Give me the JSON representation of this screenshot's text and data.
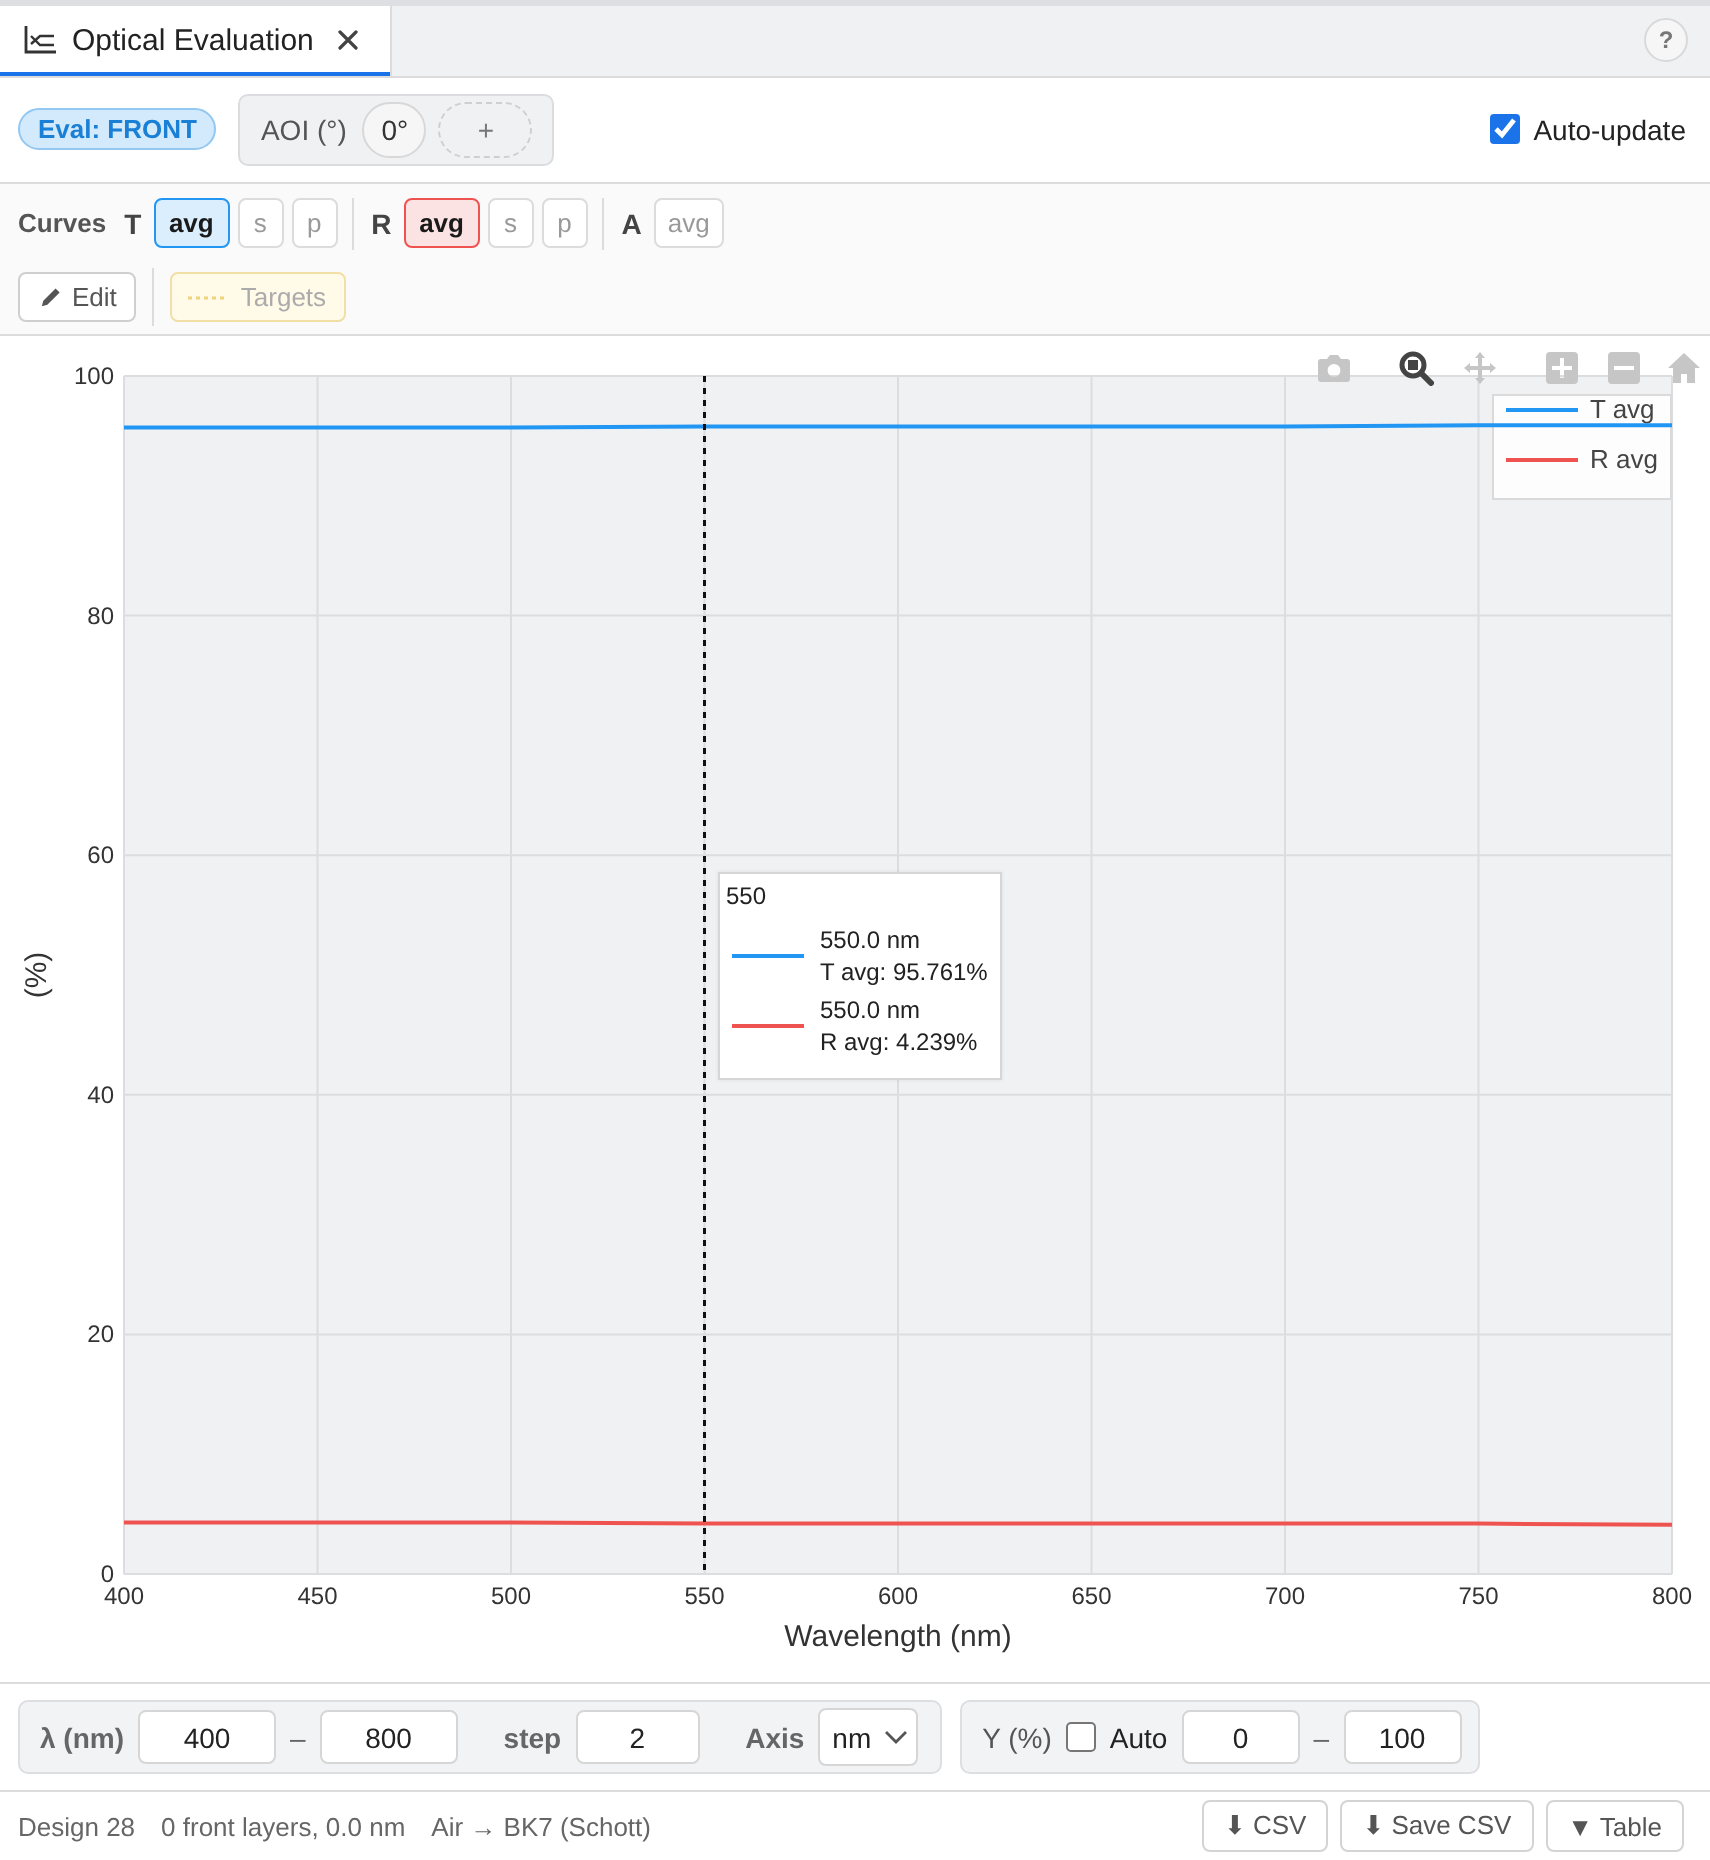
{
  "tab_bar": {
    "tabs": [
      {
        "label": "Optical Evaluation",
        "selected": true
      }
    ],
    "help": "?"
  },
  "toolbar": {
    "eval_badge": "Eval: FRONT",
    "aoi": {
      "label": "AOI (°)",
      "angles": [
        "0°"
      ],
      "add": "+"
    },
    "auto_update": {
      "label": "Auto-update",
      "checked": true
    }
  },
  "curves": {
    "label": "Curves",
    "groups": [
      {
        "name": "T",
        "color": "#2196f3",
        "options": [
          {
            "label": "avg",
            "selected": true
          },
          {
            "label": "s",
            "selected": false
          },
          {
            "label": "p",
            "selected": false
          }
        ]
      },
      {
        "name": "R",
        "color": "#ef5350",
        "options": [
          {
            "label": "avg",
            "selected": true
          },
          {
            "label": "s",
            "selected": false
          },
          {
            "label": "p",
            "selected": false
          }
        ]
      },
      {
        "name": "A",
        "options": [
          {
            "label": "avg",
            "selected": false
          }
        ]
      }
    ],
    "edit": "Edit",
    "targets": {
      "label": "Targets",
      "disabled": true
    }
  },
  "chart": {
    "modebar": [
      {
        "kind": "camera",
        "selected": false
      },
      {
        "kind": "zoom",
        "selected": true
      },
      {
        "kind": "pan",
        "selected": false
      },
      {
        "kind": "zoom_in",
        "selected": false
      },
      {
        "kind": "zoom_out",
        "selected": false
      },
      {
        "kind": "home",
        "selected": false
      }
    ],
    "chart_data": {
      "type": "line",
      "xlabel": "Wavelength (nm)",
      "ylabel": "(%)",
      "x": [
        400,
        450,
        500,
        550,
        600,
        650,
        700,
        750,
        800
      ],
      "series": [
        {
          "name": "T avg",
          "color": "#2196f3",
          "values": [
            95.7,
            95.7,
            95.7,
            95.8,
            95.8,
            95.8,
            95.8,
            95.9,
            95.9
          ]
        },
        {
          "name": "R avg",
          "color": "#ef5350",
          "values": [
            4.3,
            4.3,
            4.3,
            4.2,
            4.2,
            4.2,
            4.2,
            4.2,
            4.1
          ]
        }
      ],
      "xlim": [
        400,
        800
      ],
      "ylim": [
        0,
        100
      ],
      "xticks": [
        {
          "value": 400,
          "label": "400"
        },
        {
          "value": 450,
          "label": "450"
        },
        {
          "value": 500,
          "label": "500"
        },
        {
          "value": 550,
          "label": "550"
        },
        {
          "value": 600,
          "label": "600"
        },
        {
          "value": 650,
          "label": "650"
        },
        {
          "value": 700,
          "label": "700"
        },
        {
          "value": 750,
          "label": "750"
        },
        {
          "value": 800,
          "label": "800"
        }
      ],
      "yticks": [
        {
          "value": 0,
          "label": "0"
        },
        {
          "value": 20,
          "label": "20"
        },
        {
          "value": 40,
          "label": "40"
        },
        {
          "value": 60,
          "label": "60"
        },
        {
          "value": 80,
          "label": "80"
        },
        {
          "value": 100,
          "label": "100"
        }
      ],
      "grid": true,
      "legend": true,
      "ref_lines": [
        {
          "axis": "x",
          "value": 550
        }
      ]
    },
    "tooltip": {
      "title": "550",
      "entries": [
        {
          "lines": [
            "550.0 nm",
            "T avg: 95.761%"
          ]
        },
        {
          "lines": [
            "550.0 nm",
            "R avg: 4.239%"
          ]
        }
      ]
    }
  },
  "range_bar": {
    "wavelength": {
      "label": "λ (nm)",
      "min": "400",
      "separator": "–",
      "max": "800",
      "step_label": "step",
      "step": "2",
      "axis_label": "Axis",
      "axis": "nm"
    },
    "y": {
      "label": "Y (%)",
      "auto": {
        "label": "Auto",
        "checked": false
      },
      "min": "0",
      "separator": "–",
      "max": "100"
    }
  },
  "status_bar": {
    "items": [
      "Design 28",
      "0 front layers, 0.0 nm",
      "Air → BK7 (Schott)"
    ],
    "buttons": [
      "⬇ CSV",
      "⬇ Save CSV",
      "▼ Table"
    ]
  }
}
